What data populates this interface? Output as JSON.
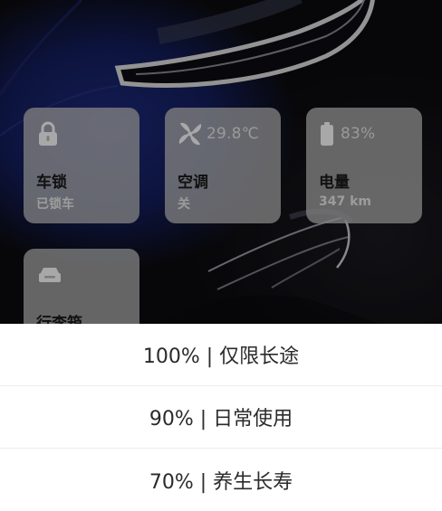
{
  "cards": {
    "lock": {
      "icon": "lock-icon",
      "title": "车锁",
      "status": "已锁车"
    },
    "ac": {
      "icon": "fan-icon",
      "temperature": "29.8℃",
      "title": "空调",
      "status": "关"
    },
    "battery": {
      "icon": "battery-icon",
      "percent": "83%",
      "title": "电量",
      "range": "347 km"
    },
    "trunk": {
      "icon": "trunk-icon",
      "title": "行李箱"
    }
  },
  "charge_limit_options": [
    {
      "label": "100% | 仅限长途"
    },
    {
      "label": "90% | 日常使用"
    },
    {
      "label": "70% | 养生长寿"
    }
  ],
  "colors": {
    "card_bg": "#808080",
    "sheet_bg": "#ffffff",
    "car_body": "#141e5e"
  }
}
